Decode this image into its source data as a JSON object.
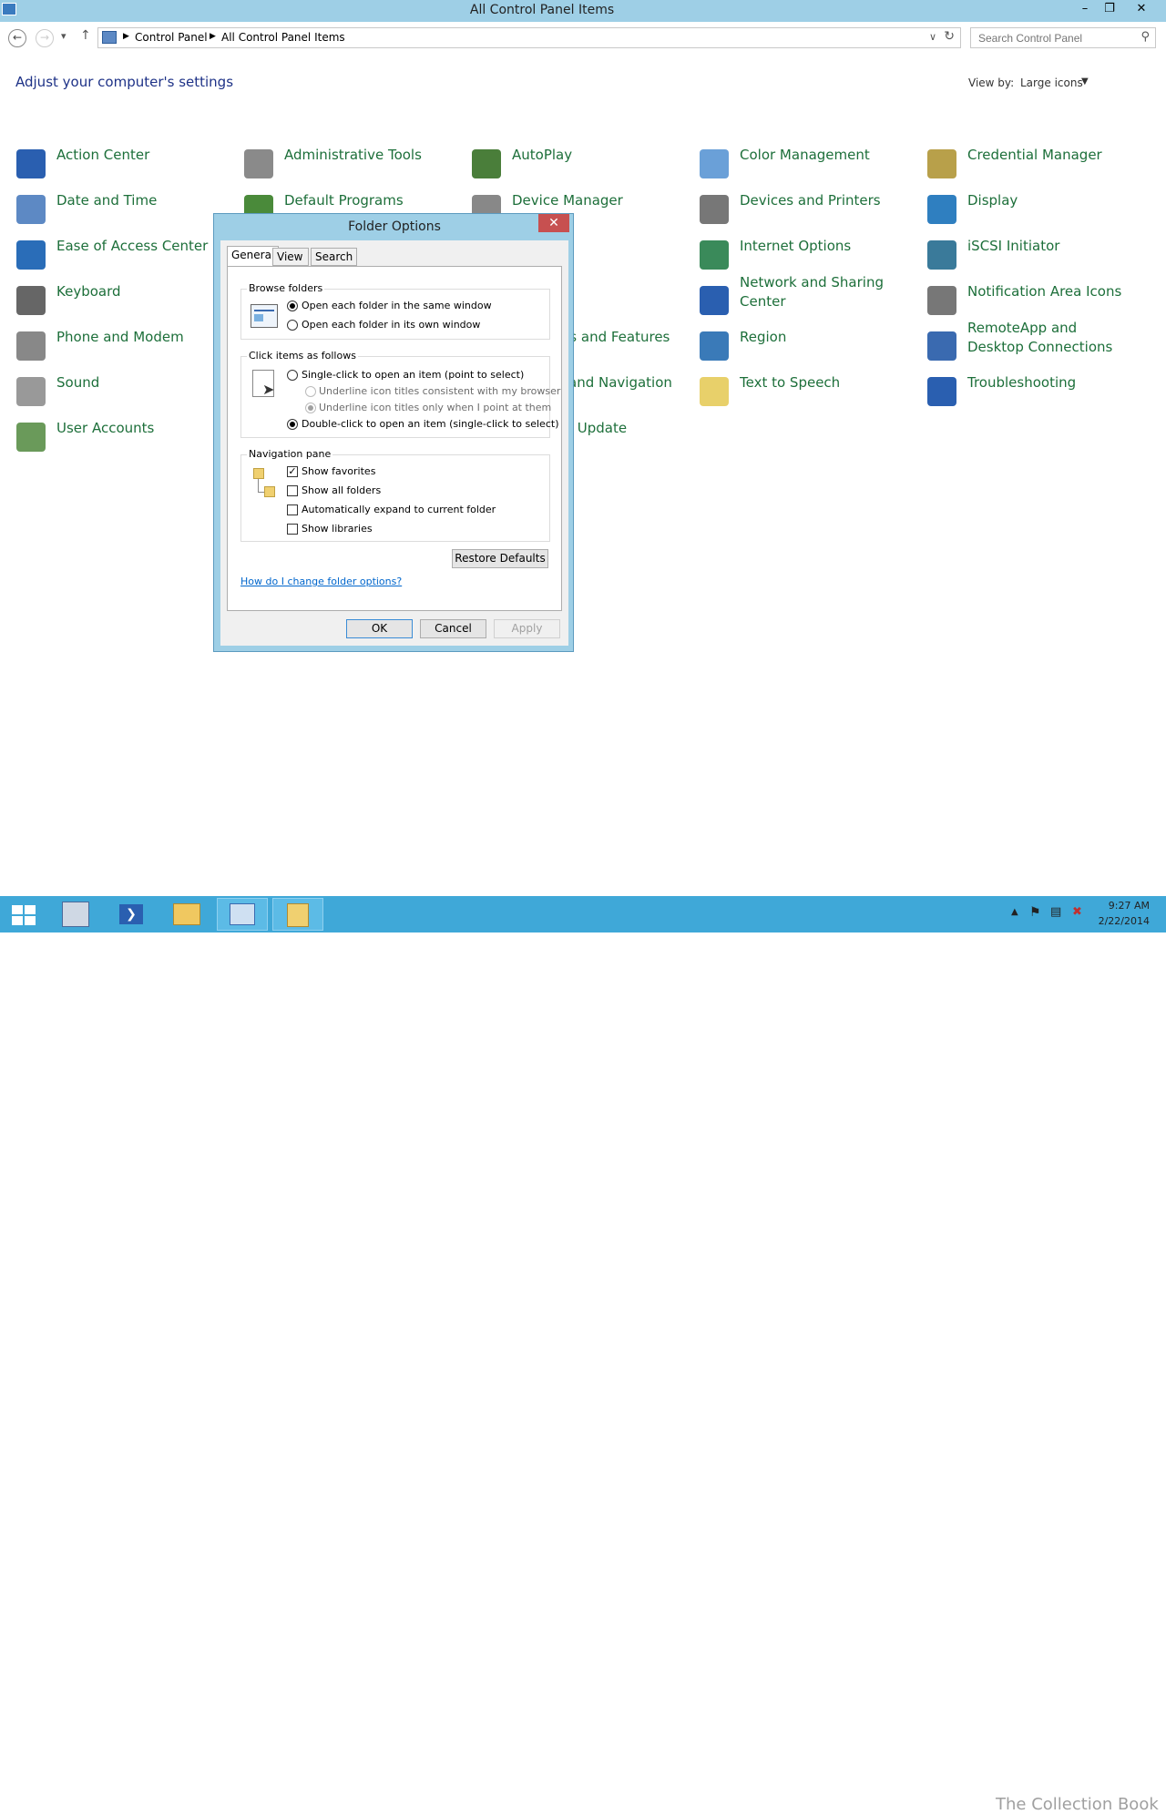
{
  "window": {
    "title": "All Control Panel Items"
  },
  "address": {
    "crumbs": [
      "Control Panel",
      "All Control Panel Items"
    ],
    "search_placeholder": "Search Control Panel"
  },
  "header": {
    "heading": "Adjust your computer's settings",
    "viewby_label": "View by:",
    "viewby_value": "Large icons"
  },
  "items": [
    {
      "label": "Action Center",
      "color": "#2a5fb0"
    },
    {
      "label": "Administrative Tools",
      "color": "#8a8a8a"
    },
    {
      "label": "AutoPlay",
      "color": "#4a7e3a"
    },
    {
      "label": "Color Management",
      "color": "#6aa0d8"
    },
    {
      "label": "Credential Manager",
      "color": "#b8a04a"
    },
    {
      "label": "Date and Time",
      "color": "#5d89c4"
    },
    {
      "label": "Default Programs",
      "color": "#4a8a3a"
    },
    {
      "label": "Device Manager",
      "color": "#888888"
    },
    {
      "label": "Devices and Printers",
      "color": "#777777"
    },
    {
      "label": "Display",
      "color": "#2f7fc0"
    },
    {
      "label": "Ease of Access Center",
      "color": "#2a6db8"
    },
    {
      "label": "Internet Options",
      "color": "#3a8a5a"
    },
    {
      "label": "iSCSI Initiator",
      "color": "#3a7a9a"
    },
    {
      "label": "Keyboard",
      "color": "#666666"
    },
    {
      "label": "Network and Sharing Center",
      "color": "#2a5fb0"
    },
    {
      "label": "Notification Area Icons",
      "color": "#777777"
    },
    {
      "label": "Phone and Modem",
      "color": "#888888"
    },
    {
      "label": "Programs and Features",
      "color": "#6a6a6a"
    },
    {
      "label": "Region",
      "color": "#3a7ab8"
    },
    {
      "label": "RemoteApp and Desktop Connections",
      "color": "#3a6ab0"
    },
    {
      "label": "Sound",
      "color": "#999999"
    },
    {
      "label": "Taskbar and Navigation",
      "color": "#777777"
    },
    {
      "label": "Text to Speech",
      "color": "#e8d06a"
    },
    {
      "label": "Troubleshooting",
      "color": "#2a5fb0"
    },
    {
      "label": "User Accounts",
      "color": "#6a9a5a"
    },
    {
      "label": "Windows Update",
      "color": "#3a6ab0"
    }
  ],
  "dialog": {
    "title": "Folder Options",
    "tabs": [
      "General",
      "View",
      "Search"
    ],
    "browse": {
      "label": "Browse folders",
      "opt1": "Open each folder in the same window",
      "opt2": "Open each folder in its own window"
    },
    "click": {
      "label": "Click items as follows",
      "opt1": "Single-click to open an item (point to select)",
      "sub1": "Underline icon titles consistent with my browser",
      "sub2": "Underline icon titles only when I point at them",
      "opt2": "Double-click to open an item (single-click to select)"
    },
    "nav": {
      "label": "Navigation pane",
      "c1": "Show favorites",
      "c2": "Show all folders",
      "c3": "Automatically expand to current folder",
      "c4": "Show libraries"
    },
    "restore": "Restore Defaults",
    "help_link": "How do I change folder options?",
    "ok": "OK",
    "cancel": "Cancel",
    "apply": "Apply"
  },
  "taskbar": {
    "time": "9:27 AM",
    "date": "2/22/2014",
    "watermark": "The Collection Book"
  }
}
